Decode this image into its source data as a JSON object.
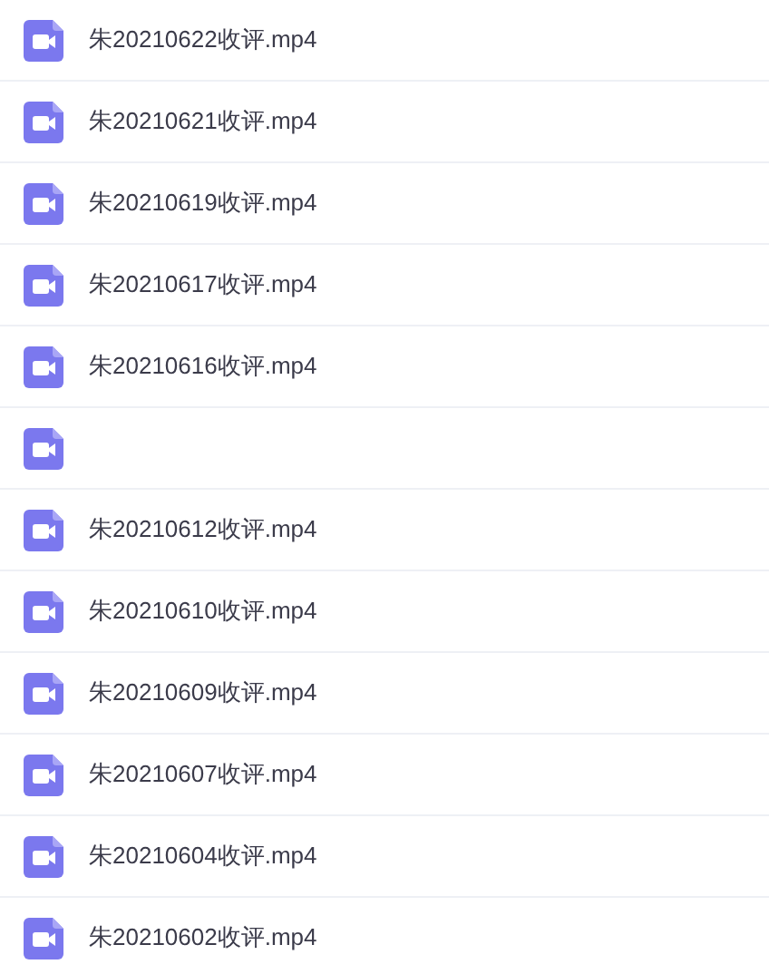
{
  "files": [
    {
      "kind": "video",
      "name": "朱20210622收评.mp4"
    },
    {
      "kind": "video",
      "name": "朱20210621收评.mp4"
    },
    {
      "kind": "video",
      "name": "朱20210619收评.mp4"
    },
    {
      "kind": "video",
      "name": "朱20210617收评.mp4"
    },
    {
      "kind": "video",
      "name": "朱20210616收评.mp4"
    },
    {
      "kind": "video"
    },
    {
      "kind": "video",
      "name": "朱20210612收评.mp4"
    },
    {
      "kind": "video",
      "name": "朱20210610收评.mp4"
    },
    {
      "kind": "video",
      "name": "朱20210609收评.mp4"
    },
    {
      "kind": "video",
      "name": "朱20210607收评.mp4"
    },
    {
      "kind": "video",
      "name": "朱20210604收评.mp4"
    },
    {
      "kind": "video",
      "name": "朱20210602收评.mp4"
    }
  ]
}
